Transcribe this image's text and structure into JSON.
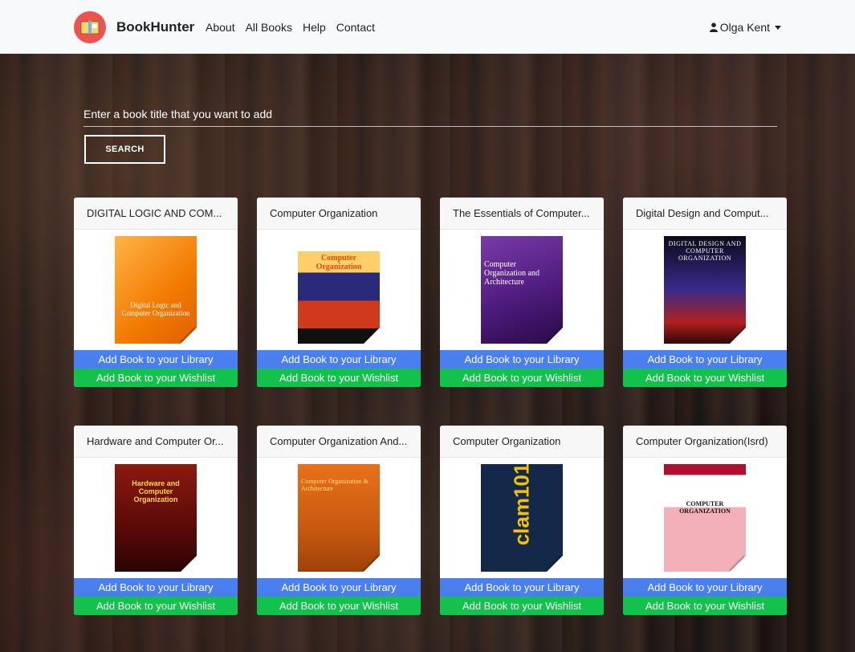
{
  "brand": {
    "name": "BookHunter",
    "logo_icon": "book-icon",
    "logo_color": "#ef5350"
  },
  "nav": {
    "links": [
      "About",
      "All Books",
      "Help",
      "Contact"
    ]
  },
  "user": {
    "name": "Olga Kent",
    "icon": "user-icon"
  },
  "search": {
    "placeholder": "Enter a book title that you want to add",
    "button_label": "SEARCH"
  },
  "actions": {
    "add_library": "Add Book to your Library",
    "add_wishlist": "Add Book to your Wishlist",
    "library_color": "#4a7ff0",
    "wishlist_color": "#13c24d"
  },
  "books": [
    {
      "title": "DIGITAL LOGIC AND COM...",
      "cover_text": "Digital Logic and Computer Organization"
    },
    {
      "title": "Computer Organization",
      "cover_text": "Computer Organization"
    },
    {
      "title": "The Essentials of Computer...",
      "cover_text": "Computer Organization and Architecture"
    },
    {
      "title": "Digital Design and Comput...",
      "cover_text": "DIGITAL DESIGN AND COMPUTER ORGANIZATION"
    },
    {
      "title": "Hardware and Computer Or...",
      "cover_text": "Hardware and Computer Organization"
    },
    {
      "title": "Computer Organization And...",
      "cover_text": "Computer Organization & Architecture"
    },
    {
      "title": "Computer Organization",
      "cover_text": "clam101"
    },
    {
      "title": "Computer Organization(Isrd)",
      "cover_text": "COMPUTER ORGANIZATION"
    }
  ]
}
